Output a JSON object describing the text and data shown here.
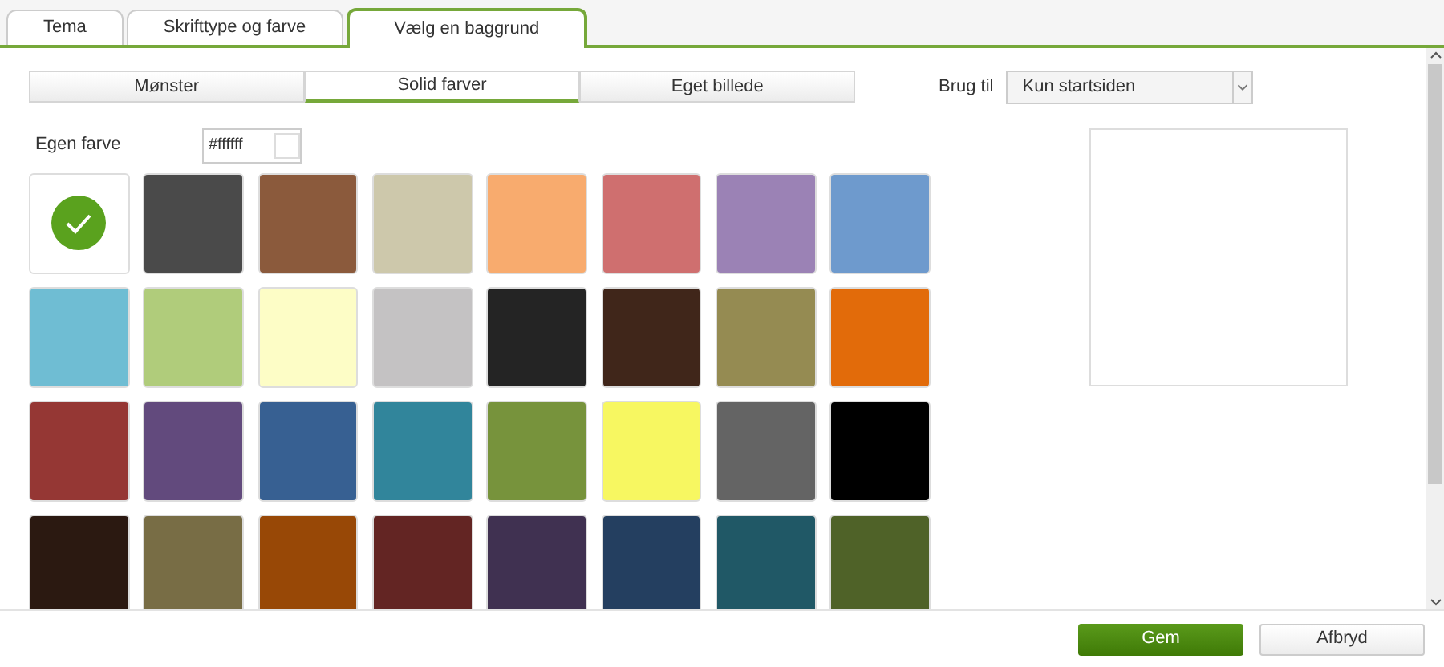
{
  "tabs": [
    {
      "label": "Tema",
      "selected": false
    },
    {
      "label": "Skrifttype og farve",
      "selected": false
    },
    {
      "label": "Vælg en baggrund",
      "selected": true
    }
  ],
  "segments": [
    {
      "label": "Mønster",
      "selected": false
    },
    {
      "label": "Solid farver",
      "selected": true
    },
    {
      "label": "Eget billede",
      "selected": false
    }
  ],
  "apply_to": {
    "label": "Brug til",
    "value": "Kun startsiden"
  },
  "custom_color": {
    "label": "Egen farve",
    "value": "#ffffff"
  },
  "swatches": [
    {
      "color": "#ffffff",
      "selected": true
    },
    {
      "color": "#4a4a4a",
      "selected": false
    },
    {
      "color": "#8b5a3c",
      "selected": false
    },
    {
      "color": "#cdc8ab",
      "selected": false
    },
    {
      "color": "#f8ab6e",
      "selected": false
    },
    {
      "color": "#cf6f6f",
      "selected": false
    },
    {
      "color": "#9b82b5",
      "selected": false
    },
    {
      "color": "#6e9acd",
      "selected": false
    },
    {
      "color": "#6fbdd3",
      "selected": false
    },
    {
      "color": "#b0cc7b",
      "selected": false
    },
    {
      "color": "#fdfdc6",
      "selected": false
    },
    {
      "color": "#c4c2c3",
      "selected": false
    },
    {
      "color": "#242424",
      "selected": false
    },
    {
      "color": "#40261a",
      "selected": false
    },
    {
      "color": "#958b52",
      "selected": false
    },
    {
      "color": "#e26b0a",
      "selected": false
    },
    {
      "color": "#953734",
      "selected": false
    },
    {
      "color": "#624a7d",
      "selected": false
    },
    {
      "color": "#376092",
      "selected": false
    },
    {
      "color": "#31859b",
      "selected": false
    },
    {
      "color": "#77933c",
      "selected": false
    },
    {
      "color": "#f7f761",
      "selected": false
    },
    {
      "color": "#646464",
      "selected": false
    },
    {
      "color": "#000000",
      "selected": false
    },
    {
      "color": "#2b1911",
      "selected": false
    },
    {
      "color": "#786d45",
      "selected": false
    },
    {
      "color": "#984806",
      "selected": false
    },
    {
      "color": "#632523",
      "selected": false
    },
    {
      "color": "#403151",
      "selected": false
    },
    {
      "color": "#243f60",
      "selected": false
    },
    {
      "color": "#205866",
      "selected": false
    },
    {
      "color": "#4f6228",
      "selected": false
    }
  ],
  "buttons": [
    {
      "label": "Gem",
      "kind": "primary"
    },
    {
      "label": "Afbryd",
      "kind": "secondary"
    }
  ]
}
